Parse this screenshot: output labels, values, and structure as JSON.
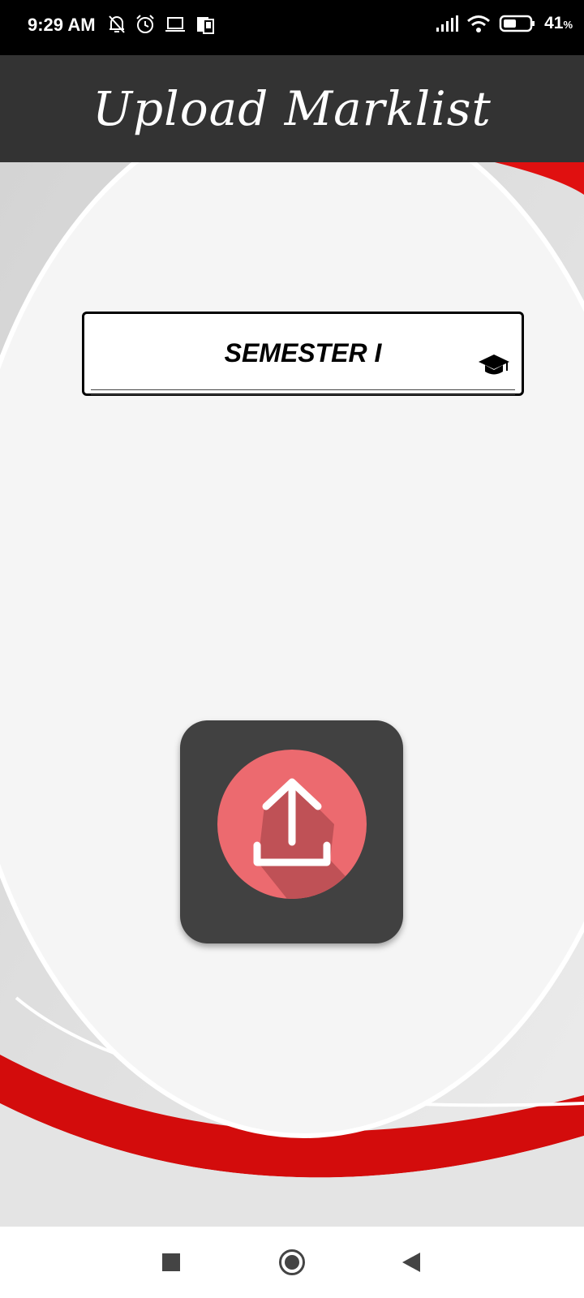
{
  "status_bar": {
    "time": "9:29 AM",
    "battery_percent": "41",
    "battery_unit": "%",
    "icons": [
      "bell-off-icon",
      "alarm-icon",
      "laptop-icon",
      "phone-icon",
      "signal-icon",
      "wifi-icon",
      "battery-icon"
    ]
  },
  "app_bar": {
    "title": "Upload Marklist"
  },
  "main": {
    "semester_selector": {
      "label": "SEMESTER I",
      "icon": "graduation-cap-icon"
    },
    "upload_button": {
      "icon": "upload-icon",
      "circle_color": "#ec6a6f",
      "tile_color": "#414141"
    }
  },
  "nav_bar": {
    "buttons": [
      "recent-apps",
      "home",
      "back"
    ]
  },
  "colors": {
    "accent_red": "#e01010",
    "app_bar": "#333333"
  }
}
